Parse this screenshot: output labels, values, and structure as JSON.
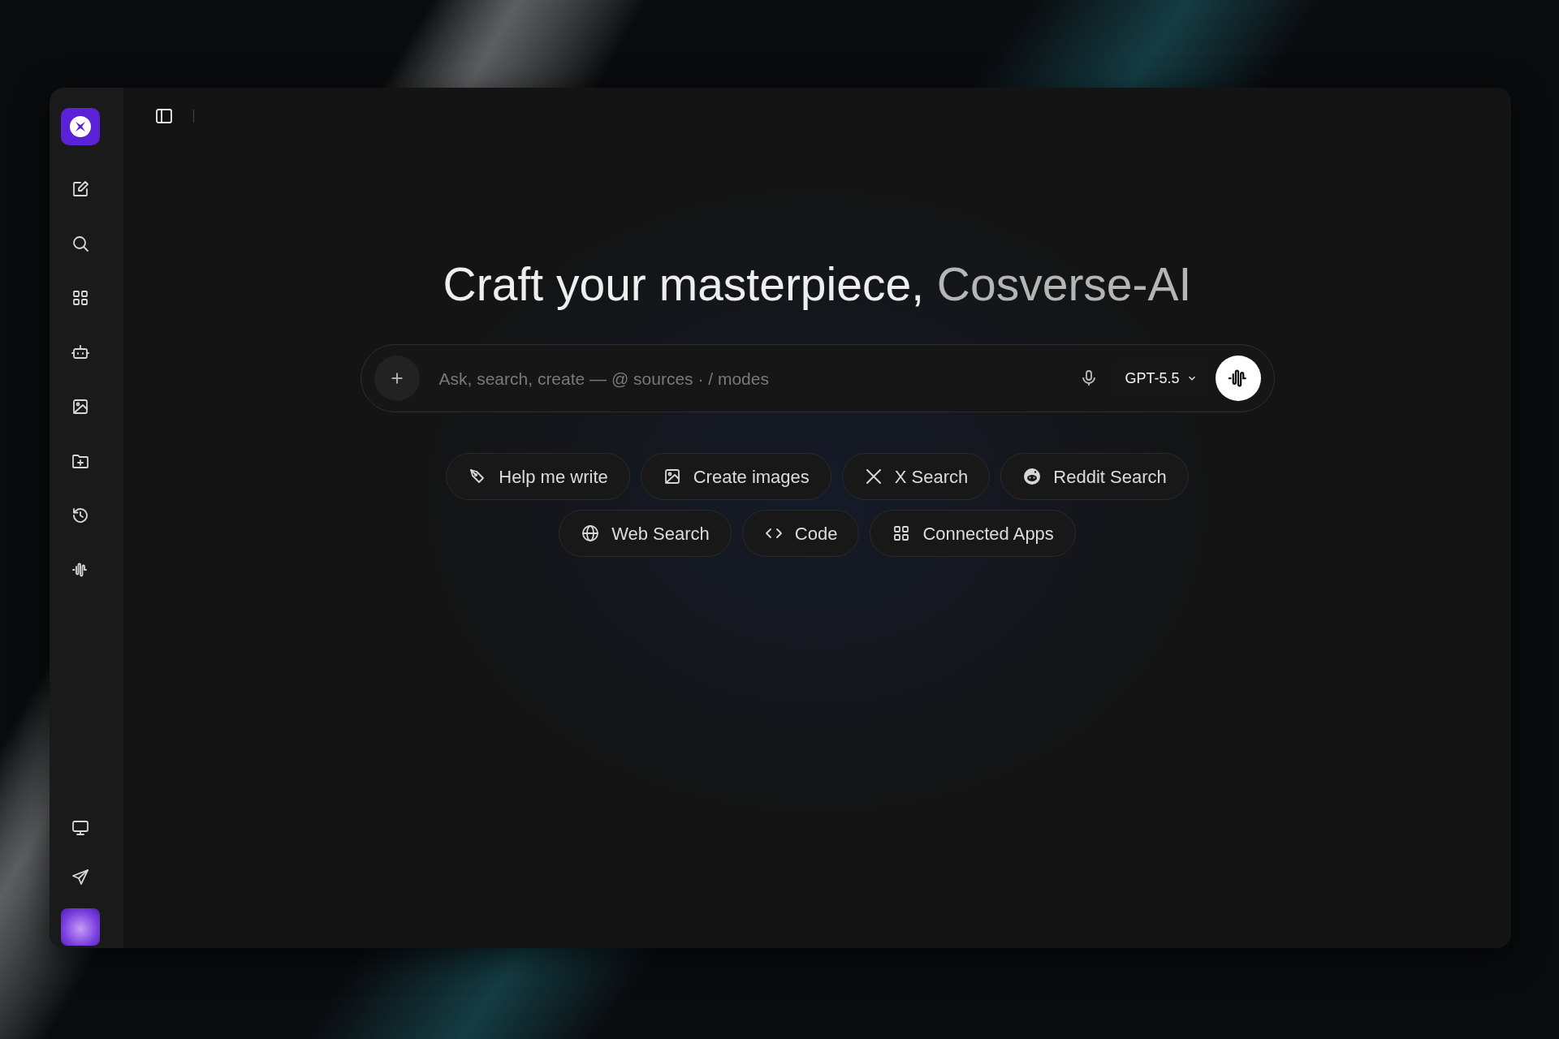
{
  "heading": {
    "text": "Craft your masterpiece, ",
    "highlight": "Cosverse-AI"
  },
  "composer": {
    "placeholder": "Ask, search, create — @ sources · / modes",
    "model": "GPT-5.5"
  },
  "suggestions": [
    {
      "label": "Help me write"
    },
    {
      "label": "Create images"
    },
    {
      "label": "X Search"
    },
    {
      "label": "Reddit Search"
    },
    {
      "label": "Web Search"
    },
    {
      "label": "Code"
    },
    {
      "label": "Connected Apps"
    }
  ]
}
